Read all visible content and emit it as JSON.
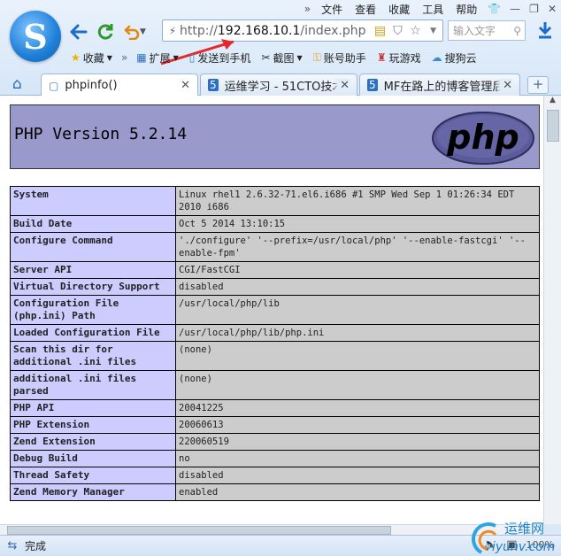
{
  "menubar": {
    "items": [
      "文件",
      "查看",
      "收藏",
      "工具",
      "帮助"
    ],
    "more": "»"
  },
  "nav": {
    "url_prefix": "http://",
    "url_host": "192.168.10.1",
    "url_path": "/index.php",
    "search_placeholder": "输入文字"
  },
  "bookmarks": {
    "favorites_label": "收藏",
    "items": [
      {
        "label": "扩展",
        "icon": "puzzle-icon"
      },
      {
        "label": "发送到手机",
        "icon": "phone-icon"
      },
      {
        "label": "截图",
        "icon": "scissors-icon"
      },
      {
        "label": "账号助手",
        "icon": "key-icon"
      },
      {
        "label": "玩游戏",
        "icon": "game-icon"
      },
      {
        "label": "搜狗云",
        "icon": "cloud-icon"
      }
    ]
  },
  "tabs": [
    {
      "label": "phpinfo()",
      "active": true
    },
    {
      "label": "运维学习 - 51CTO技术",
      "active": false
    },
    {
      "label": "MF在路上的博客管理后",
      "active": false
    }
  ],
  "phpinfo": {
    "title": "PHP Version 5.2.14",
    "logo_text": "php",
    "rows": [
      {
        "k": "System",
        "v": "Linux rhel1 2.6.32-71.el6.i686 #1 SMP Wed Sep 1 01:26:34 EDT 2010 i686"
      },
      {
        "k": "Build Date",
        "v": "Oct 5 2014 13:10:15"
      },
      {
        "k": "Configure Command",
        "v": "'./configure' '--prefix=/usr/local/php' '--enable-fastcgi' '--enable-fpm'"
      },
      {
        "k": "Server API",
        "v": "CGI/FastCGI"
      },
      {
        "k": "Virtual Directory Support",
        "v": "disabled"
      },
      {
        "k": "Configuration File (php.ini) Path",
        "v": "/usr/local/php/lib"
      },
      {
        "k": "Loaded Configuration File",
        "v": "/usr/local/php/lib/php.ini"
      },
      {
        "k": "Scan this dir for additional .ini files",
        "v": "(none)"
      },
      {
        "k": "additional .ini files parsed",
        "v": "(none)"
      },
      {
        "k": "PHP API",
        "v": "20041225"
      },
      {
        "k": "PHP Extension",
        "v": "20060613"
      },
      {
        "k": "Zend Extension",
        "v": "220060519"
      },
      {
        "k": "Debug Build",
        "v": "no"
      },
      {
        "k": "Thread Safety",
        "v": "disabled"
      },
      {
        "k": "Zend Memory Manager",
        "v": "enabled"
      }
    ]
  },
  "status": {
    "text": "完成",
    "zoom": "100%"
  },
  "watermark": {
    "cn": "运维网",
    "domain": "iyunv.com"
  },
  "colors": {
    "php_header_bg": "#9999cc",
    "key_cell_bg": "#ccccff",
    "value_cell_bg": "#cccccc",
    "annotation_arrow": "#e8262b"
  }
}
